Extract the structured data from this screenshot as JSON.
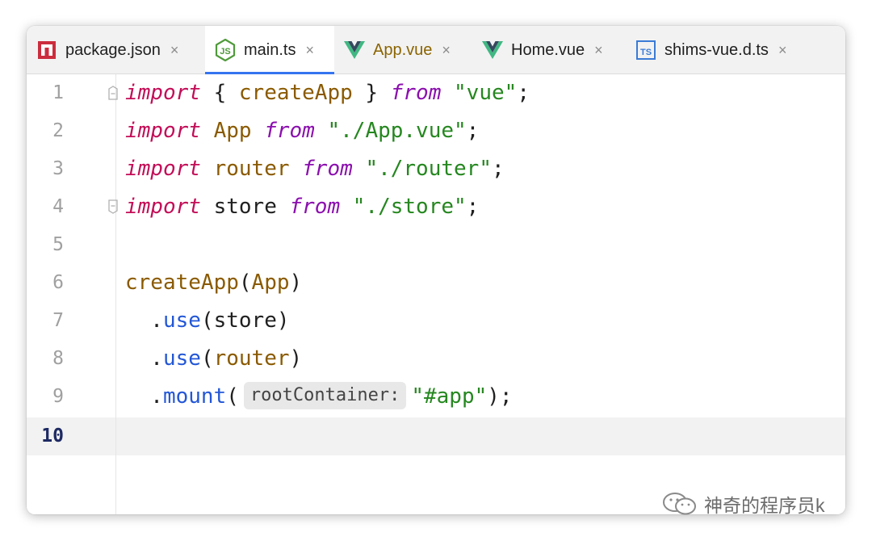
{
  "tabs": [
    {
      "label": "package.json",
      "icon": "npm-package-icon",
      "active": false,
      "color": "#1f1f1f"
    },
    {
      "label": "main.ts",
      "icon": "nodejs-icon",
      "active": true,
      "color": "#1f1f1f"
    },
    {
      "label": "App.vue",
      "icon": "vue-icon",
      "active": false,
      "color": "#8a6400"
    },
    {
      "label": "Home.vue",
      "icon": "vue-icon",
      "active": false,
      "color": "#1f1f1f"
    },
    {
      "label": "shims-vue.d.ts",
      "icon": "typescript-file-icon",
      "active": false,
      "color": "#1f1f1f"
    }
  ],
  "tab_close_glyph": "×",
  "editor": {
    "current_line": 10,
    "line_numbers": [
      "1",
      "2",
      "3",
      "4",
      "5",
      "6",
      "7",
      "8",
      "9",
      "10"
    ],
    "inlay_hint": "rootContainer:",
    "code": {
      "l1": [
        "import",
        " { ",
        "createApp",
        " } ",
        "from",
        " ",
        "\"vue\"",
        ";"
      ],
      "l2": [
        "import",
        " ",
        "App",
        " ",
        "from",
        " ",
        "\"./App.vue\"",
        ";"
      ],
      "l3": [
        "import",
        " ",
        "router",
        " ",
        "from",
        " ",
        "\"./router\"",
        ";"
      ],
      "l4": [
        "import",
        " store ",
        "from",
        " ",
        "\"./store\"",
        ";"
      ],
      "l6": [
        "createApp",
        "(",
        "App",
        ")"
      ],
      "l7": [
        "  .",
        "use",
        "(store)"
      ],
      "l8": [
        "  .",
        "use",
        "(",
        "router",
        ")"
      ],
      "l9": [
        "  .",
        "mount",
        "(",
        "\"#app\"",
        ");"
      ]
    }
  },
  "watermark": "神奇的程序员k",
  "colors": {
    "keyword": "#c30d57",
    "from_keyword": "#8b0fae",
    "identifier": "#8a5a00",
    "string": "#25871f",
    "method": "#2357d6",
    "active_tab_underline": "#3574f0"
  }
}
